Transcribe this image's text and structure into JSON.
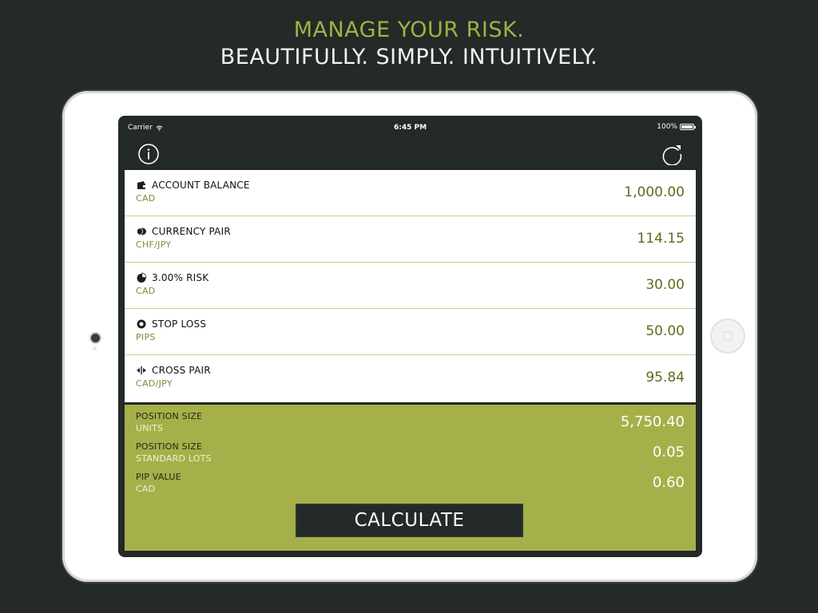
{
  "headline": {
    "line1": "MANAGE YOUR RISK.",
    "line2": "BEAUTIFULLY. SIMPLY. INTUITIVELY."
  },
  "status_bar": {
    "carrier": "Carrier",
    "time": "6:45 PM",
    "battery": "100%"
  },
  "nav": {
    "info_icon": "info-icon",
    "refresh_icon": "refresh-icon"
  },
  "inputs": [
    {
      "icon": "wallet-icon",
      "label": "ACCOUNT BALANCE",
      "sub": "CAD",
      "value": "1,000.00"
    },
    {
      "icon": "coins-icon",
      "label": "CURRENCY PAIR",
      "sub": "CHF/JPY",
      "value": "114.15"
    },
    {
      "icon": "pie-chart-icon",
      "label": "3.00% RISK",
      "sub": "CAD",
      "value": "30.00"
    },
    {
      "icon": "stop-icon",
      "label": "STOP LOSS",
      "sub": "PIPS",
      "value": "50.00"
    },
    {
      "icon": "cross-arrows-icon",
      "label": "CROSS PAIR",
      "sub": "CAD/JPY",
      "value": "95.84"
    }
  ],
  "results": [
    {
      "label": "POSITION SIZE",
      "sub": "UNITS",
      "value": "5,750.40"
    },
    {
      "label": "POSITION SIZE",
      "sub": "STANDARD LOTS",
      "value": "0.05"
    },
    {
      "label": "PIP VALUE",
      "sub": "CAD",
      "value": "0.60"
    }
  ],
  "calculate_label": "CALCULATE",
  "colors": {
    "accent": "#a5b04a",
    "background": "#232a27",
    "value_text": "#5c6d1e"
  }
}
